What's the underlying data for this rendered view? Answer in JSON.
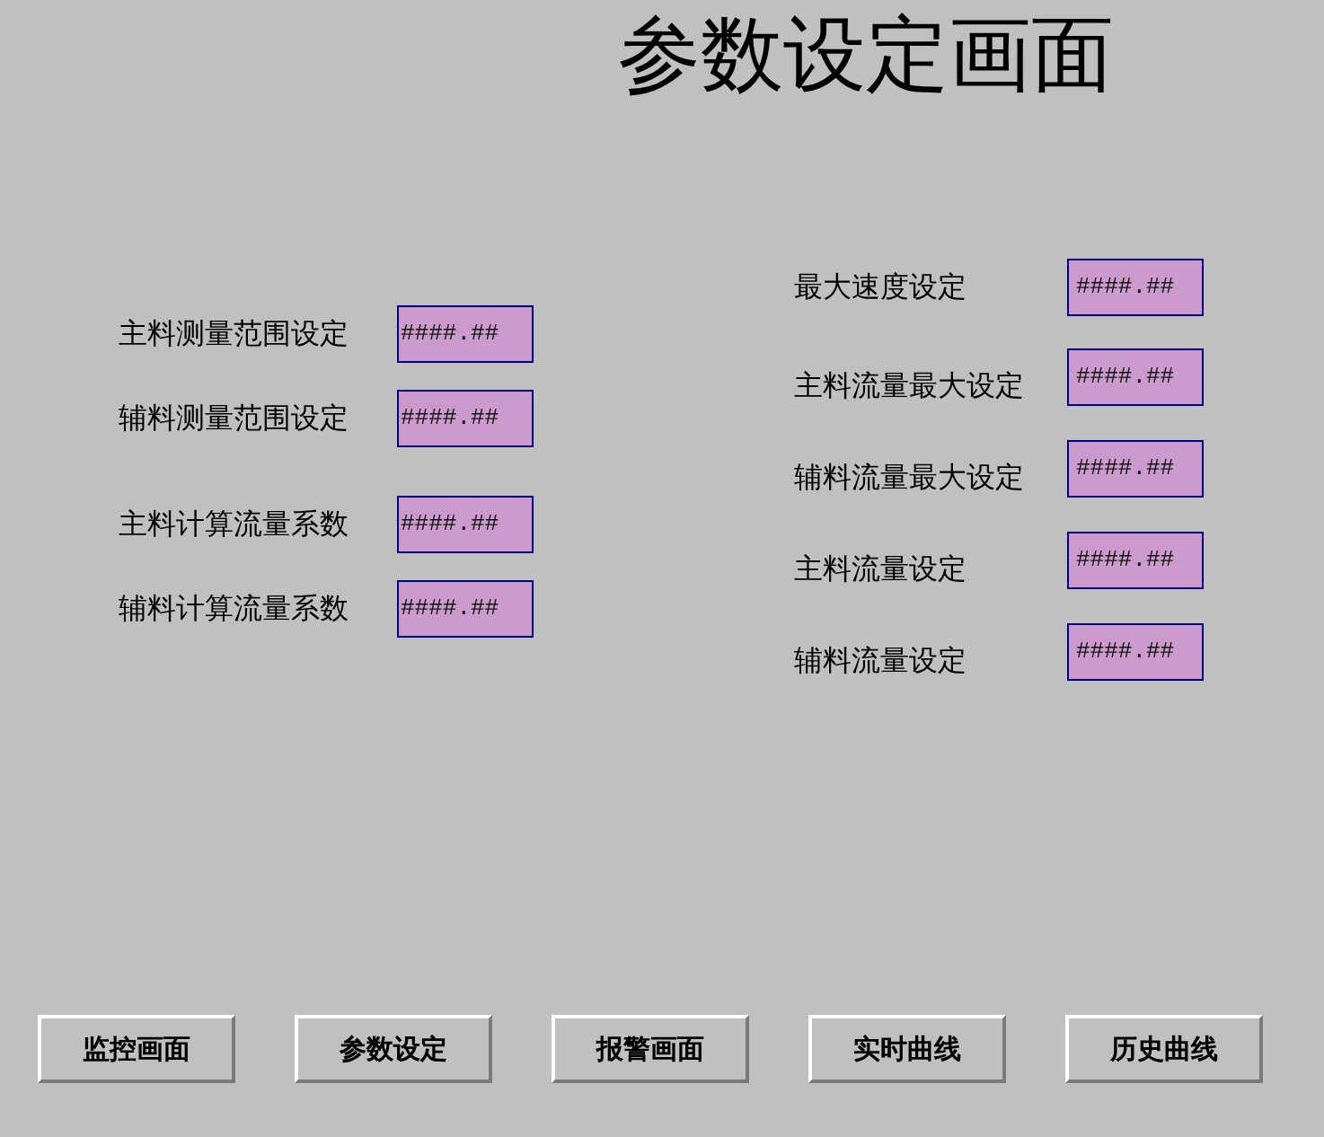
{
  "title": "参数设定画面",
  "left_groups": [
    {
      "fields": [
        {
          "label": "主料测量范围设定",
          "value": "####.##"
        },
        {
          "label": "辅料测量范围设定",
          "value": "####.##"
        }
      ]
    },
    {
      "fields": [
        {
          "label": "主料计算流量系数",
          "value": "####.##"
        },
        {
          "label": "辅料计算流量系数",
          "value": "####.##"
        }
      ]
    }
  ],
  "right_fields": [
    {
      "label": "最大速度设定",
      "value": "####.##"
    },
    {
      "label": "主料流量最大设定",
      "value": "####.##"
    },
    {
      "label": "辅料流量最大设定",
      "value": "####.##"
    },
    {
      "label": "主料流量设定",
      "value": "####.##"
    },
    {
      "label": "辅料流量设定",
      "value": "####.##"
    }
  ],
  "nav_buttons": [
    {
      "label": "监控画面"
    },
    {
      "label": "参数设定"
    },
    {
      "label": "报警画面"
    },
    {
      "label": "实时曲线"
    },
    {
      "label": "历史曲线"
    }
  ]
}
